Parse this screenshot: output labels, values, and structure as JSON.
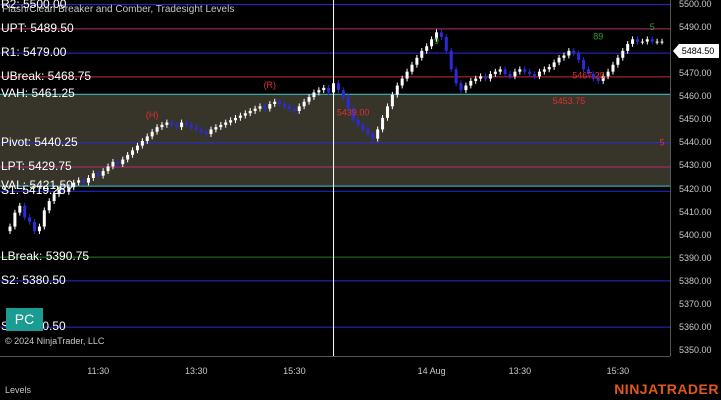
{
  "chart": {
    "title": "Flash/Clean Breaker and Comber, Tradesight Levels",
    "copyright": "© 2024 NinjaTrader, LLC",
    "badge": "PC"
  },
  "levels": [
    {
      "id": "r2",
      "label": "R2: 5500.00",
      "price": 5500.0,
      "color": "#2b2bd9"
    },
    {
      "id": "upt",
      "label": "UPT: 5489.50",
      "price": 5489.5,
      "color": "#b0306a"
    },
    {
      "id": "r1",
      "label": "R1: 5479.00",
      "price": 5479.0,
      "color": "#2b2bd9"
    },
    {
      "id": "ubreak",
      "label": "UBreak: 5468.75",
      "price": 5468.75,
      "color": "#c83030"
    },
    {
      "id": "vah",
      "label": "VAH: 5461.25",
      "price": 5461.25,
      "color": "#40c8d0"
    },
    {
      "id": "pivot",
      "label": "Pivot: 5440.25",
      "price": 5440.25,
      "color": "#2b2bd9"
    },
    {
      "id": "lpt",
      "label": "LPT: 5429.75",
      "price": 5429.75,
      "color": "#b0306a"
    },
    {
      "id": "val",
      "label": "VAL: 5421.50",
      "price": 5421.5,
      "color": "#40c8d0"
    },
    {
      "id": "s1",
      "label": "S1: 5419.25",
      "price": 5419.25,
      "color": "#2b2bd9"
    },
    {
      "id": "lbreak",
      "label": "LBreak: 5390.75",
      "price": 5390.75,
      "color": "#208020"
    },
    {
      "id": "s2",
      "label": "S2: 5380.50",
      "price": 5380.5,
      "color": "#2b2bd9"
    },
    {
      "id": "s3",
      "label": "S3: 5360.50",
      "price": 5360.5,
      "color": "#2b2bd9"
    }
  ],
  "value_area": {
    "high": 5461.25,
    "low": 5421.5,
    "color": "#4a4538"
  },
  "price_axis": {
    "min": 5348,
    "max": 5502,
    "ticks": [
      "5500.00",
      "5490.00",
      "5480.00",
      "5470.00",
      "5460.00",
      "5450.00",
      "5440.00",
      "5430.00",
      "5420.00",
      "5410.00",
      "5400.00",
      "5390.00",
      "5380.00",
      "5370.00",
      "5360.00",
      "5350.00"
    ],
    "tick_values": [
      5500,
      5490,
      5480,
      5470,
      5460,
      5450,
      5440,
      5430,
      5420,
      5410,
      5400,
      5390,
      5380,
      5370,
      5360,
      5350
    ],
    "last_price": "5484.50"
  },
  "time_axis": {
    "ticks": [
      "11:30",
      "13:30",
      "15:30",
      "14 Aug",
      "13:30",
      "15:30"
    ],
    "tick_index": [
      18,
      38,
      58,
      86,
      104,
      124
    ],
    "session_break_index": 66
  },
  "annotations": [
    {
      "text": "(H)",
      "color": "#e03030",
      "i": 29,
      "price": 5451
    },
    {
      "text": "(R)",
      "color": "#e03030",
      "i": 53,
      "price": 5464
    },
    {
      "text": "5439.00",
      "color": "#e03030",
      "i": 70,
      "price": 5452
    },
    {
      "text": "5453.75",
      "color": "#e03030",
      "i": 114,
      "price": 5457
    },
    {
      "text": "5467.25",
      "color": "#e03030",
      "i": 118,
      "price": 5468
    },
    {
      "text": "5",
      "color": "#e03030",
      "i": 133,
      "price": 5439
    },
    {
      "text": "9",
      "color": "#2ea02e",
      "i": 87,
      "price": 5483
    },
    {
      "text": "89",
      "color": "#2ea02e",
      "i": 120,
      "price": 5485
    },
    {
      "text": "5",
      "color": "#2ea02e",
      "i": 131,
      "price": 5489
    }
  ],
  "bottom": {
    "tab": "Levels",
    "brand_a": "NINJA",
    "brand_b": "TRADER"
  },
  "colors": {
    "bull": "#ffffff",
    "bear": "#2b2bd9",
    "session_line": "#ffffff"
  },
  "chart_data": {
    "type": "candlestick",
    "series": [
      {
        "name": "close",
        "values": [
          5404,
          5410,
          5413,
          5408,
          5406,
          5402,
          5404,
          5411,
          5415,
          5418,
          5420,
          5419,
          5421,
          5423,
          5424,
          5423,
          5425,
          5427,
          5426,
          5428,
          5430,
          5432,
          5431,
          5433,
          5435,
          5437,
          5439,
          5441,
          5443,
          5445,
          5447,
          5448,
          5449,
          5448,
          5447,
          5449,
          5448,
          5447,
          5446,
          5445,
          5444,
          5446,
          5447,
          5448,
          5449,
          5450,
          5451,
          5452,
          5453,
          5454,
          5455,
          5456,
          5455,
          5457,
          5458,
          5457,
          5456,
          5455,
          5454,
          5456,
          5458,
          5460,
          5462,
          5463,
          5464,
          5462,
          5466,
          5463,
          5460,
          5455,
          5450,
          5448,
          5446,
          5444,
          5442,
          5446,
          5451,
          5456,
          5461,
          5465,
          5468,
          5471,
          5474,
          5477,
          5480,
          5482,
          5485,
          5488,
          5486,
          5480,
          5472,
          5466,
          5463,
          5465,
          5467,
          5468,
          5469,
          5468,
          5470,
          5471,
          5472,
          5470,
          5469,
          5471,
          5472,
          5471,
          5470,
          5469,
          5471,
          5472,
          5473,
          5475,
          5477,
          5478,
          5480,
          5479,
          5476,
          5472,
          5470,
          5468,
          5467,
          5469,
          5471,
          5474,
          5477,
          5480,
          5483,
          5485,
          5484,
          5484,
          5485,
          5484,
          5484,
          5484
        ]
      }
    ]
  }
}
